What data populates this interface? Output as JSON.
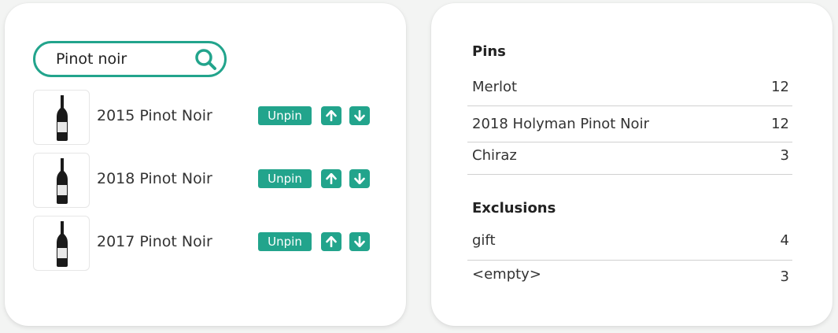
{
  "search": {
    "value": "Pinot noir",
    "placeholder": ""
  },
  "results": [
    {
      "title": "2015 Pinot Noir",
      "unpin_label": "Unpin"
    },
    {
      "title": "2018 Pinot Noir",
      "unpin_label": "Unpin"
    },
    {
      "title": "2017 Pinot Noir",
      "unpin_label": "Unpin"
    }
  ],
  "pins": {
    "title": "Pins",
    "rows": [
      {
        "label": "Merlot",
        "count": "12"
      },
      {
        "label": "2018 Holyman Pinot Noir",
        "count": "12"
      },
      {
        "label": "Chiraz",
        "count": "3"
      }
    ]
  },
  "exclusions": {
    "title": "Exclusions",
    "rows": [
      {
        "label": "gift",
        "count": "4"
      },
      {
        "label": "<empty>",
        "count": "3"
      }
    ]
  },
  "colors": {
    "accent": "#22a48c",
    "background": "#f3f4f3",
    "card": "#ffffff"
  },
  "icons": {
    "search": "search-icon",
    "up": "arrow-up-icon",
    "down": "arrow-down-icon",
    "bottle": "wine-bottle-icon"
  }
}
